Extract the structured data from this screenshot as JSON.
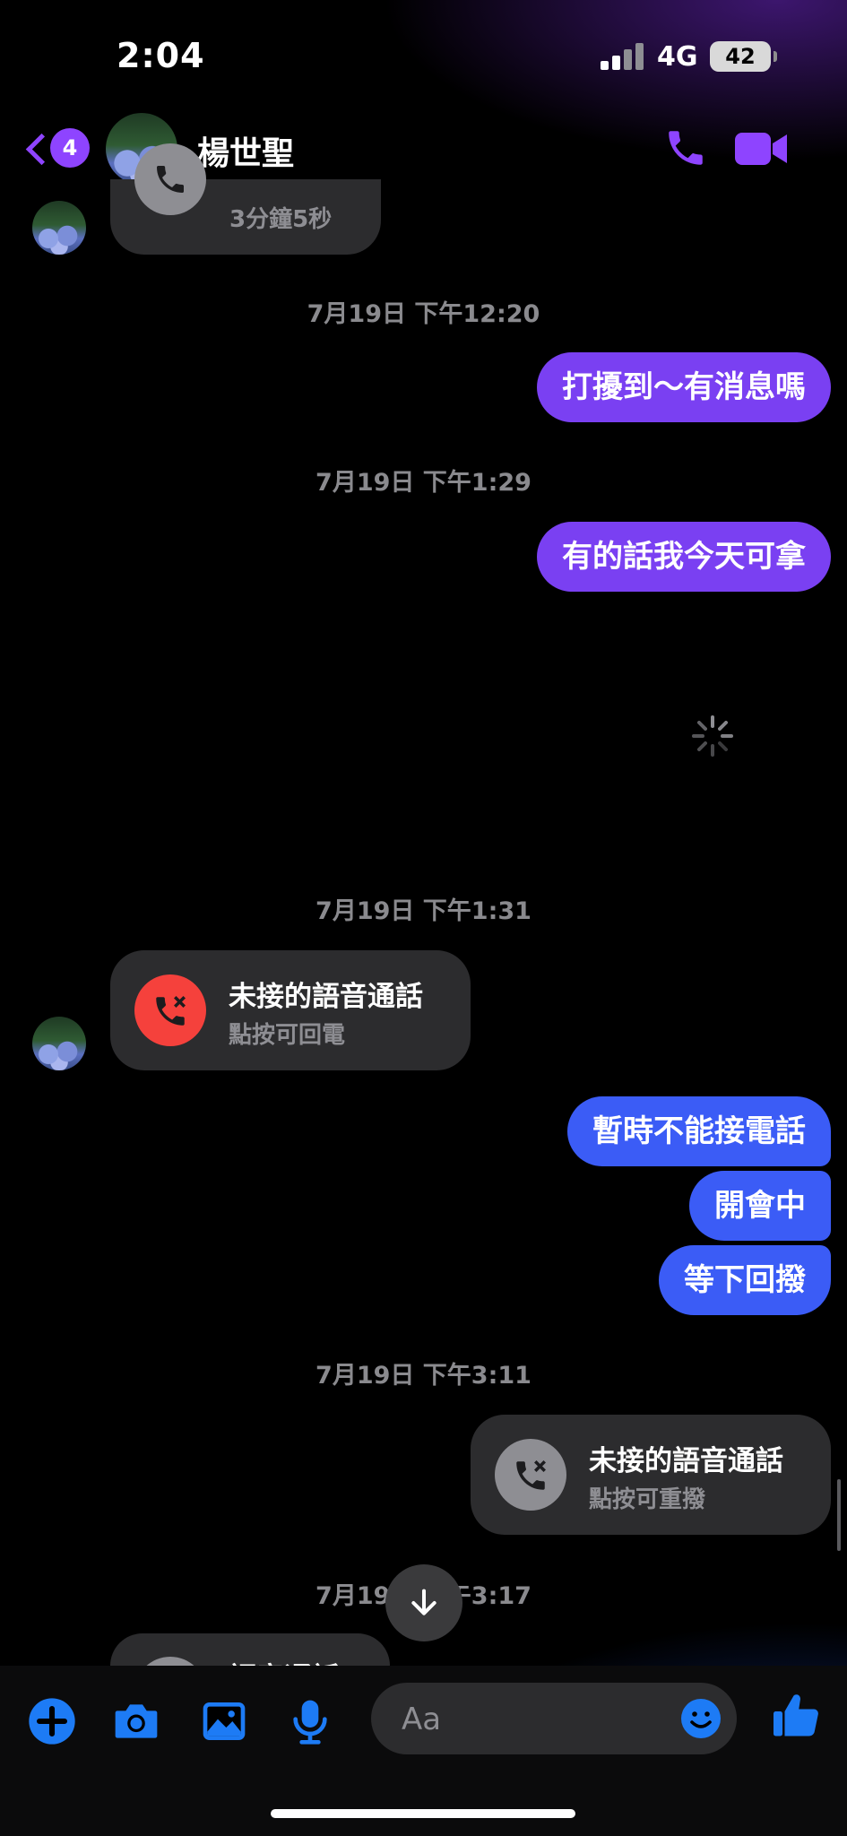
{
  "status": {
    "time": "2:04",
    "network": "4G",
    "battery": "42"
  },
  "header": {
    "back_badge": "4",
    "contact_name": "楊世聖"
  },
  "messages": {
    "call1": {
      "duration": "3分鐘5秒"
    },
    "ts1": "7月19日 下午12:20",
    "out1": "打擾到～有消息嗎",
    "ts2": "7月19日 下午1:29",
    "out2": "有的話我今天可拿",
    "ts3": "7月19日 下午1:31",
    "missed_in": {
      "title": "未接的語音通話",
      "subtitle": "點按可回電"
    },
    "out3": "暫時不能接電話",
    "out4": "開會中",
    "out5": "等下回撥",
    "ts4": "7月19日 下午3:11",
    "missed_out": {
      "title": "未接的語音通話",
      "subtitle": "點按可重撥"
    },
    "ts5": "7月19日 下午3:17",
    "call_partial": {
      "title": "語音通話"
    }
  },
  "composer": {
    "placeholder": "Aa"
  },
  "colors": {
    "accent_purple": "#7a40f2",
    "accent_blue": "#3b5cf6",
    "missed_red": "#f5413c",
    "icon_blue": "#1d7bf5"
  }
}
